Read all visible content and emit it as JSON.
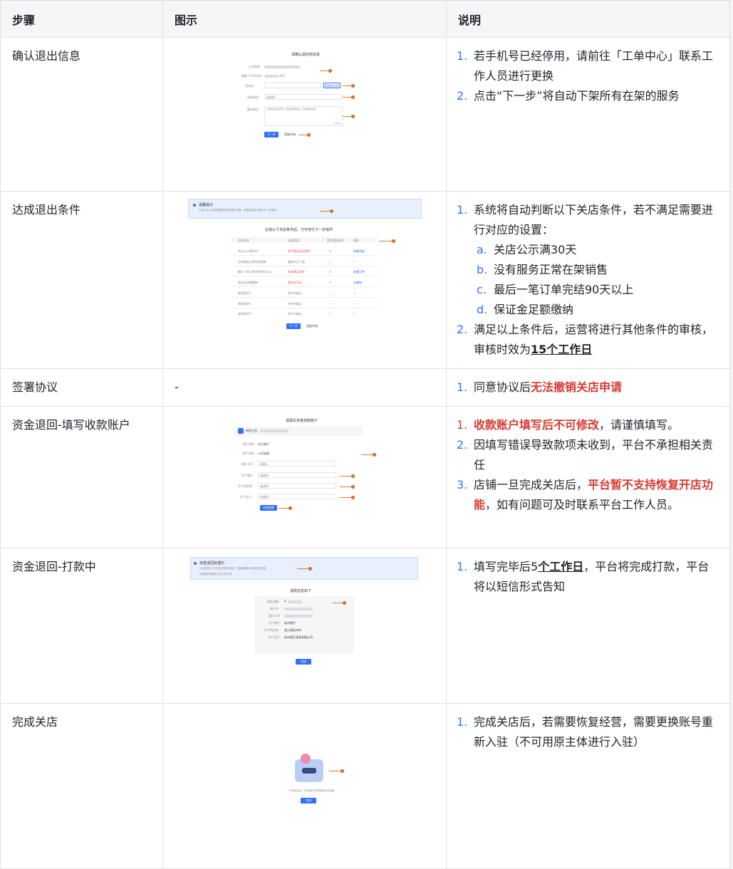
{
  "header": {
    "col_step": "步骤",
    "col_fig": "图示",
    "col_desc": "说明"
  },
  "rows": [
    {
      "step": "确认退出信息",
      "mock": {
        "title": "请确认退店商信息",
        "f1": "公司名称",
        "f2": "管理人手机号码",
        "f3": "验证码",
        "f4": "退店原因",
        "f5": "备注意见",
        "f3_ph": "请输入",
        "f4_ph": "请选择",
        "f5_ph": "请填写退店的原因，若您有其他建议，欢迎留言反馈",
        "send": "获取验证码",
        "next": "下一步",
        "cancel": "暂缓申请",
        "count": "0/200",
        "phone_tail": "900"
      },
      "items": [
        "若手机号已经停用，请前往「工单中心」联系工作人员进行更换",
        "点击“下一步”将自动下架所有在架的服务"
      ]
    },
    {
      "step": "达成退出条件",
      "mock": {
        "tip_title": "温馨提示",
        "tip_text": "平台工作人员将根据您的情况进行审核，审核通过后可进行下一步操作。",
        "subtitle": "达成以下关店条件后，方可进行下一步操作",
        "cols": [
          "关店条件",
          "当前状态",
          "是否满足条件",
          "操作"
        ],
        "rows": [
          [
            "关店公示满30天",
            "尚不满足关店条件",
            "✕",
            "查看进度"
          ],
          [
            "没有服务正常在架销售",
            "服务均已下架",
            "✓",
            "—"
          ],
          [
            "最后一笔订单完结90天以上",
            "尚未满足条件",
            "✕",
            "查看订单"
          ],
          [
            "保证金足额缴纳",
            "保证金不足",
            "✕",
            "去缴纳"
          ],
          [
            "其他条件1",
            "待平台确认",
            "—",
            "—"
          ],
          [
            "其他条件2",
            "待平台确认",
            "—",
            "—"
          ],
          [
            "其他条件3",
            "待平台确认",
            "—",
            "—"
          ]
        ],
        "next": "下一步",
        "cancel": "暂缓申请"
      },
      "items": [
        "系统将自动判断以下关店条件，若不满足需要进行对应的设置："
      ],
      "sub_items": [
        {
          "label": "a.",
          "text": "关店公示满30天"
        },
        {
          "label": "b.",
          "text": "没有服务正常在架销售"
        },
        {
          "label": "c.",
          "text": "最后一笔订单完结90天以上"
        },
        {
          "label": "d.",
          "text": "保证金足额缴纳"
        }
      ],
      "item2_pre": "满足以上条件后，运营将进行其他条件的审核，审核时效为",
      "item2_em": "15个工作日"
    },
    {
      "step": "签署协议",
      "fig_text": "-",
      "item_pre": "同意协议后",
      "item_red": "无法撤销关店申请"
    },
    {
      "step": "资金退回-填写收款账户",
      "mock": {
        "title": "请填写资金收款账户",
        "company": "你好企业",
        "f1": "账户类型",
        "f1v": "对公账户",
        "f2": "账户名称",
        "f2v": "公司名称",
        "f3": "银行卡号",
        "f3p": "请输入",
        "f4": "开户银行",
        "f5": "开户所在地",
        "f6": "开户支行",
        "sel": "请选择",
        "submit": "申请退款"
      },
      "i1_red": "收款账户填写后不可修改",
      "i1_rest": "，请谨慎填写。",
      "i2": "因填写错误导致款项未收到，平台不承担相关责任",
      "i3_pre": "店铺一旦完成关店后，",
      "i3_red": "平台暂不支持恢复开店功能",
      "i3_post": "，如有问题可及时联系平台工作人员。"
    },
    {
      "step": "资金退回-打款中",
      "mock": {
        "tip_title": "资金退回处理中",
        "tip_text": "平台将在5个工作日内完成打款，打款结果将以短信形式告知",
        "tip_text2": "如有疑问请联系平台工作人员",
        "subtitle": "退款信息如下",
        "l1": "退还金额",
        "v1": "¥",
        "l2": "账户名",
        "l3": "银行卡号",
        "l4": "开户银行",
        "v4": "杭州银行",
        "l5": "开户所在地",
        "v5": "浙江省杭州市",
        "l6": "开户支行",
        "v6": "杭州银行某某有限公司",
        "btn": "完成"
      },
      "item_pre": "填写完毕后5",
      "item_em": "个工作日",
      "item_post": "，平台将完成打款，平台将以短信形式告知"
    },
    {
      "step": "完成关店",
      "mock": {
        "caption": "已完成关店，平台暂不支持恢复开店功能",
        "btn": "完成"
      },
      "item": "完成关店后，若需要恢复经营，需要更换账号重新入驻（不可用原主体进行入驻）"
    }
  ]
}
